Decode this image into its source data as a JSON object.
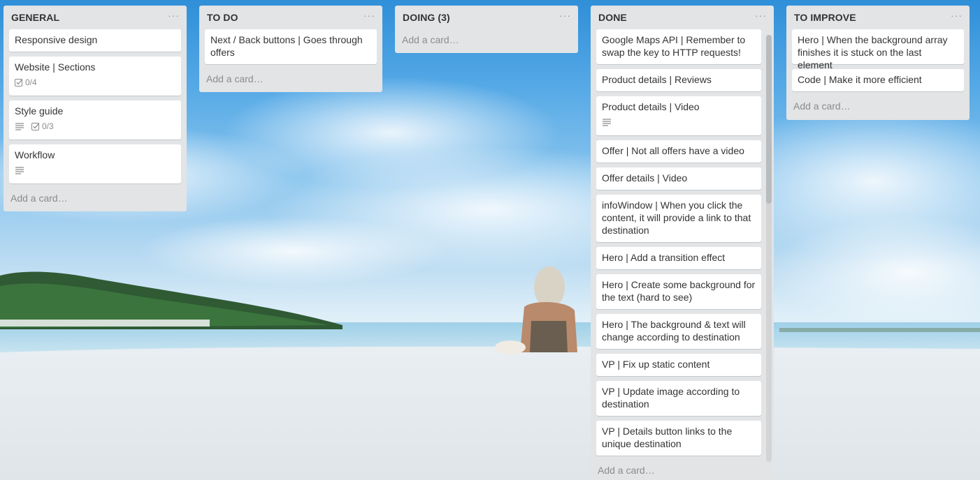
{
  "lists": [
    {
      "title": "GENERAL",
      "menu": "···",
      "add_card": "Add a card…",
      "cards": [
        {
          "title": "Responsive design"
        },
        {
          "title": "Website | Sections",
          "checklist": "0/4"
        },
        {
          "title": "Style guide",
          "checklist": "0/3"
        },
        {
          "title": "Workflow"
        }
      ]
    },
    {
      "title": "TO DO",
      "menu": "···",
      "add_card": "Add a card…",
      "cards": [
        {
          "title": "Next / Back buttons | Goes through offers"
        }
      ]
    },
    {
      "title": "DOING (3)",
      "menu": "···",
      "add_card": "Add a card…",
      "cards": []
    },
    {
      "title": "DONE",
      "menu": "···",
      "add_card": "Add a card…",
      "cards": [
        {
          "title": "Google Maps API | Remember to swap the key to HTTP requests!"
        },
        {
          "title": "Product details | Reviews"
        },
        {
          "title": "Product details | Video"
        },
        {
          "title": "Offer | Not all offers have a video"
        },
        {
          "title": "Offer details | Video"
        },
        {
          "title": "infoWindow | When you click the content, it will provide a link to that destination"
        },
        {
          "title": "Hero | Add a transition effect"
        },
        {
          "title": "Hero | Create some background for the text (hard to see)"
        },
        {
          "title": "Hero | The background & text will change according to destination"
        },
        {
          "title": "VP | Fix up static content"
        },
        {
          "title": "VP | Update image according to destination"
        },
        {
          "title": "VP | Details button links to the unique destination"
        }
      ]
    },
    {
      "title": "TO IMPROVE",
      "menu": "···",
      "add_card": "Add a card…",
      "cards": [
        {
          "title": "Hero | When the background array finishes it is stuck on the last element"
        },
        {
          "title": "Code | Make it more efficient"
        }
      ]
    }
  ],
  "icons": {
    "description": "description-icon",
    "checklist": "checklist-icon",
    "menu": "more-icon"
  },
  "colors": {
    "list_bg": "#e2e4e6",
    "card_bg": "#ffffff",
    "muted_text": "#8c8c8c"
  }
}
